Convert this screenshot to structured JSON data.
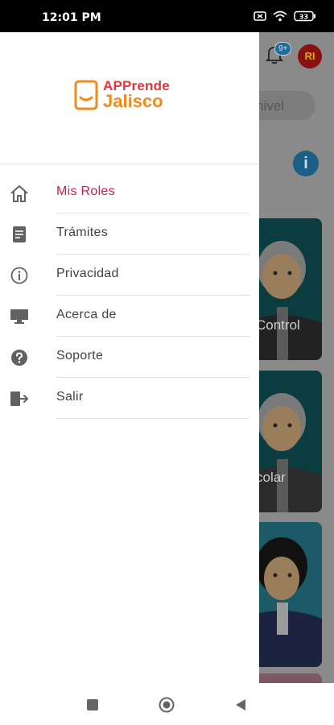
{
  "status_bar": {
    "time": "12:01 PM",
    "battery": "33"
  },
  "background": {
    "notification_badge": "9+",
    "avatar_initials": "RI",
    "search_placeholder": "nivel",
    "info_icon": "i",
    "cards": [
      {
        "label": "Control"
      },
      {
        "label": "colar"
      },
      {
        "label": ""
      }
    ]
  },
  "drawer": {
    "logo": {
      "line1": "APPrende",
      "line2": "Jalisco"
    },
    "menu": [
      {
        "label": "Mis Roles",
        "icon": "home-icon",
        "active": true
      },
      {
        "label": "Trámites",
        "icon": "document-icon",
        "active": false
      },
      {
        "label": "Privacidad",
        "icon": "info-icon",
        "active": false
      },
      {
        "label": "Acerca de",
        "icon": "monitor-icon",
        "active": false
      },
      {
        "label": "Soporte",
        "icon": "help-icon",
        "active": false
      },
      {
        "label": "Salir",
        "icon": "logout-icon",
        "active": false
      }
    ]
  },
  "colors": {
    "active": "#d21a47",
    "logo_red": "#e8333a",
    "logo_orange": "#f28a1c",
    "icon_gray": "#616161"
  }
}
